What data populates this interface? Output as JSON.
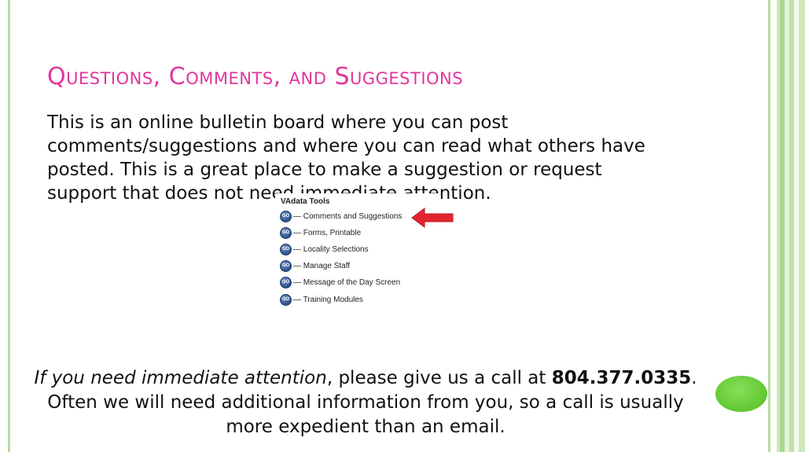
{
  "slide": {
    "title": "Questions, Comments, and Suggestions",
    "body": "This is an online bulletin board where you can post comments/suggestions and where you can read what others have posted. This is a great place to make a suggestion or request support that does not need immediate attention."
  },
  "tools_panel": {
    "title": "VAdata Tools",
    "go_label": "GO",
    "items": [
      {
        "label": "— Comments and Suggestions"
      },
      {
        "label": "— Forms, Printable"
      },
      {
        "label": "— Locality Selections"
      },
      {
        "label": "— Manage Staff"
      },
      {
        "label": "— Message of the Day Screen"
      },
      {
        "label": "— Training Modules"
      }
    ]
  },
  "footer": {
    "emphasis": "If you need immediate attention",
    "middle": ", please give us a call at ",
    "phone": "804.377.0335",
    "end": ".",
    "line2": "Often we will need additional information from you, so a call is usually more expedient than an email."
  },
  "colors": {
    "title": "#e0359c",
    "frame_green": "#b9dca2",
    "arrow_red": "#e3262e",
    "dot_green": "#6fd13e"
  }
}
